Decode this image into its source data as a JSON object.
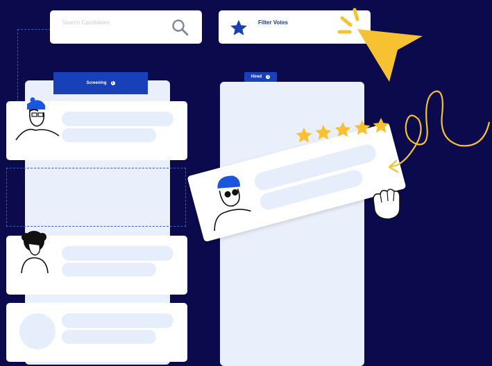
{
  "search": {
    "placeholder": "Search Candidates",
    "icon": "search-icon"
  },
  "filter": {
    "label": "Filter Votes",
    "icon": "star-icon"
  },
  "columns": [
    {
      "tag": "Screening",
      "info_icon": "info-icon"
    },
    {
      "tag": "Hired",
      "info_icon": "info-icon"
    }
  ],
  "rating": {
    "stars": 5
  },
  "colors": {
    "background": "#0b0a4d",
    "accent_blue": "#1840b8",
    "star_yellow": "#f7c232",
    "column_bg": "#eaf0fb",
    "skeleton": "#e6eefb"
  }
}
